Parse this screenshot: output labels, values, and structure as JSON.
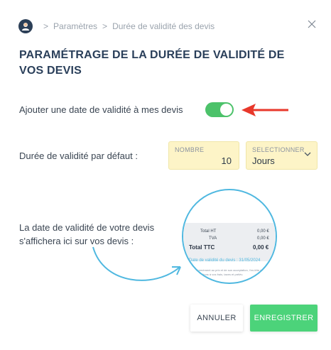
{
  "breadcrumb": {
    "items": [
      "Paramètres",
      "Durée de validité des devis"
    ],
    "separator": ">"
  },
  "title": "PARAMÉTRAGE DE LA DURÉE DE VALIDITÉ DE VOS DEVIS",
  "validity_toggle": {
    "label": "Ajouter une date de validité à mes devis",
    "checked": true,
    "color": "#4cc26a"
  },
  "default_duration": {
    "label": "Durée de validité par défaut :",
    "number": {
      "label": "NOMBRE",
      "value": "10"
    },
    "unit": {
      "label": "SELECTIONNER",
      "value": "Jours"
    }
  },
  "preview": {
    "text_line1": "La date de validité de votre devis",
    "text_line2": "s'affichera ici sur vos devis :",
    "totals": [
      {
        "label": "Total HT",
        "value": "0,00 €"
      },
      {
        "label": "TVA",
        "value": "0,00 €"
      },
      {
        "label": "Total TTC",
        "value": "0,00 €"
      }
    ],
    "validity_date": "Date de validité du devis : 31/05/2024",
    "footnote_line1": "Conformément au prix et de son acceptation, l'en-tête des",
    "footnote_line2": "informations à vos frais, taxes et prélèv."
  },
  "actions": {
    "cancel": "ANNULER",
    "save": "ENREGISTRER"
  },
  "colors": {
    "accent_green": "#4cd37a",
    "arrow_red": "#e8382b",
    "lens_blue": "#4fb8e0",
    "field_yellow": "#fdf4c7"
  }
}
